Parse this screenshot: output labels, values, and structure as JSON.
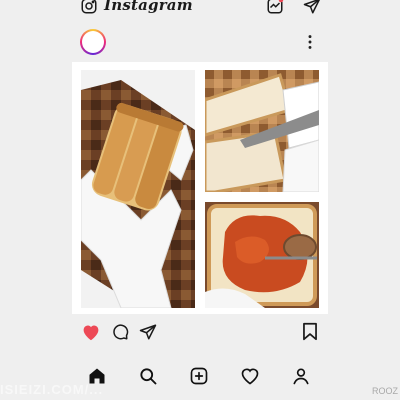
{
  "app": {
    "title": "Instagram"
  },
  "header": {
    "camera_icon": "camera-icon",
    "activity_icon": "activity-icon",
    "direct_icon": "direct-message-icon"
  },
  "post": {
    "more_icon": "more-options-icon",
    "images": [
      "bread-loaf-photo",
      "sandwich-cut-photo",
      "jam-spread-photo"
    ],
    "liked": true
  },
  "actions": {
    "like_color": "#ed4956"
  },
  "bottom_nav": {
    "items": [
      "home-icon",
      "search-icon",
      "add-post-icon",
      "heart-icon",
      "profile-icon"
    ]
  },
  "watermark_text": "ISIEIZI.COM/...",
  "corner_text": "ROOZ"
}
